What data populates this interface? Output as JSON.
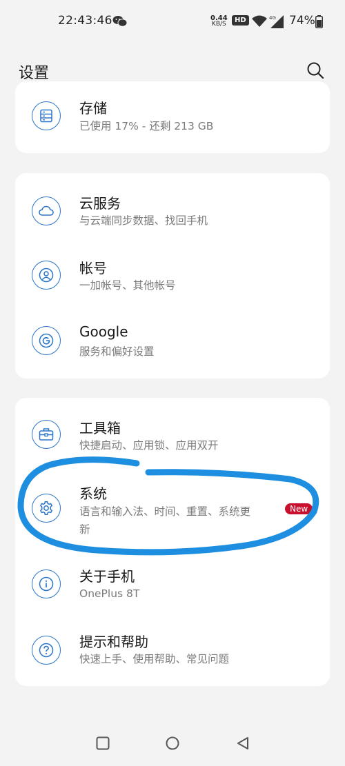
{
  "status_bar": {
    "time": "22:43:46",
    "net_speed_value": "0.44",
    "net_speed_unit": "KB/S",
    "hd": "HD",
    "network": "4G",
    "battery": "74%"
  },
  "header": {
    "title": "设置"
  },
  "groups": [
    {
      "items": [
        {
          "icon": "storage-icon",
          "label": "存储",
          "sub": "已使用 17% - 还剩 213 GB"
        }
      ]
    },
    {
      "items": [
        {
          "icon": "cloud-icon",
          "label": "云服务",
          "sub": "与云端同步数据、找回手机"
        },
        {
          "icon": "account-icon",
          "label": "帐号",
          "sub": "一加帐号、其他帐号"
        },
        {
          "icon": "google-icon",
          "label": "Google",
          "sub": "服务和偏好设置"
        }
      ]
    },
    {
      "items": [
        {
          "icon": "toolbox-icon",
          "label": "工具箱",
          "sub": "快捷启动、应用锁、应用双开"
        },
        {
          "icon": "gear-icon",
          "label": "系统",
          "sub_line1": "语言和输入法、时间、重置、系统更",
          "sub_line2": "新",
          "badge": "New"
        },
        {
          "icon": "info-icon",
          "label": "关于手机",
          "sub": "OnePlus 8T"
        },
        {
          "icon": "help-icon",
          "label": "提示和帮助",
          "sub": "快速上手、使用帮助、常见问题"
        }
      ]
    }
  ],
  "colors": {
    "accent": "#2a75c8",
    "badge": "#c8102e",
    "annotation": "#1e8fe0"
  }
}
